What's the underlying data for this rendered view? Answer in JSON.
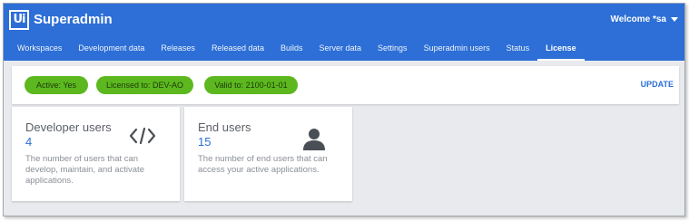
{
  "header": {
    "logo_text": "Ui",
    "app_title": "Superadmin",
    "welcome": "Welcome *sa",
    "brand_color": "#2d6fd6"
  },
  "tabs": [
    {
      "label": "Workspaces"
    },
    {
      "label": "Development data"
    },
    {
      "label": "Releases"
    },
    {
      "label": "Released data"
    },
    {
      "label": "Builds"
    },
    {
      "label": "Server data"
    },
    {
      "label": "Settings"
    },
    {
      "label": "Superadmin users"
    },
    {
      "label": "Status"
    },
    {
      "label": "License",
      "active": true
    }
  ],
  "license": {
    "active": "Active: Yes",
    "licensed_to": "Licensed to: DEV-AO",
    "valid_to": "Valid to: 2100-01-01",
    "update_label": "UPDATE",
    "pill_color": "#5cb81e"
  },
  "cards": {
    "developer": {
      "title": "Developer users",
      "count": "4",
      "description": "The number of users that can develop, maintain, and activate applications.",
      "icon": "code-icon"
    },
    "end": {
      "title": "End users",
      "count": "15",
      "description": "The number of end users that can access your active applications.",
      "icon": "person-icon"
    }
  }
}
